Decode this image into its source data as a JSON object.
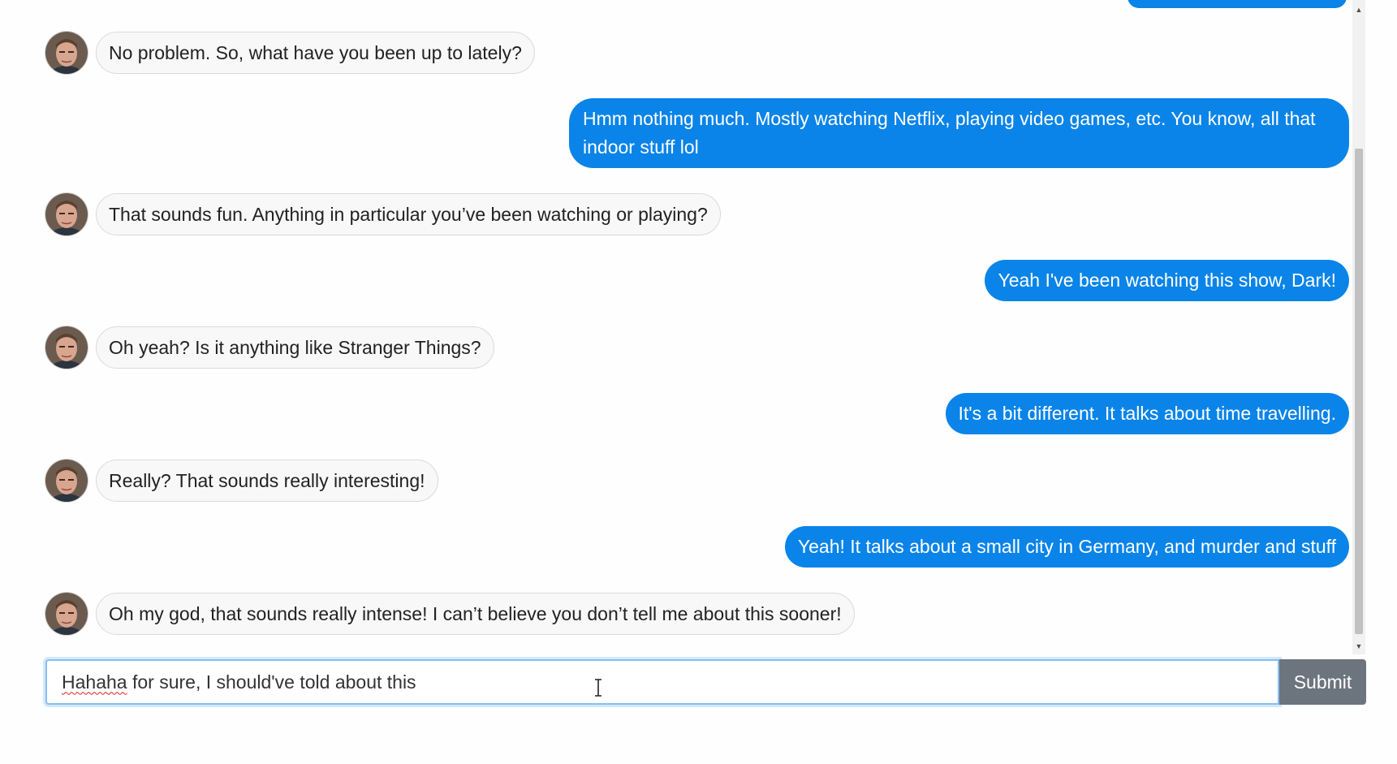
{
  "conversation": {
    "messages": [
      {
        "sender": "bot",
        "text": "No problem. So, what have you been up to lately?"
      },
      {
        "sender": "user",
        "text": "Hmm nothing much. Mostly watching Netflix, playing video games, etc. You know, all that indoor stuff lol"
      },
      {
        "sender": "bot",
        "text": "That sounds fun. Anything in particular you’ve been watching or playing?"
      },
      {
        "sender": "user",
        "text": "Yeah I've been watching this show, Dark!"
      },
      {
        "sender": "bot",
        "text": "Oh yeah? Is it anything like Stranger Things?"
      },
      {
        "sender": "user",
        "text": "It's a bit different. It talks about time travelling."
      },
      {
        "sender": "bot",
        "text": "Really? That sounds really interesting!"
      },
      {
        "sender": "user",
        "text": "Yeah! It talks about a small city in Germany, and murder and stuff"
      },
      {
        "sender": "bot",
        "text": "Oh my god, that sounds really intense! I can’t believe you don’t tell me about this sooner!"
      }
    ]
  },
  "composer": {
    "input_misspelled_word": "Hahaha",
    "input_rest": " for sure, I should've told about this",
    "submit_label": "Submit"
  },
  "colors": {
    "user_bubble": "#0a84e8",
    "bot_bubble": "#f8f8f8",
    "submit_button": "#6c757d"
  },
  "icons": {
    "avatar": "bot-avatar-photo",
    "scroll_up": "scroll-up-arrow-icon",
    "scroll_down": "scroll-down-arrow-icon",
    "cursor": "text-cursor-icon"
  }
}
